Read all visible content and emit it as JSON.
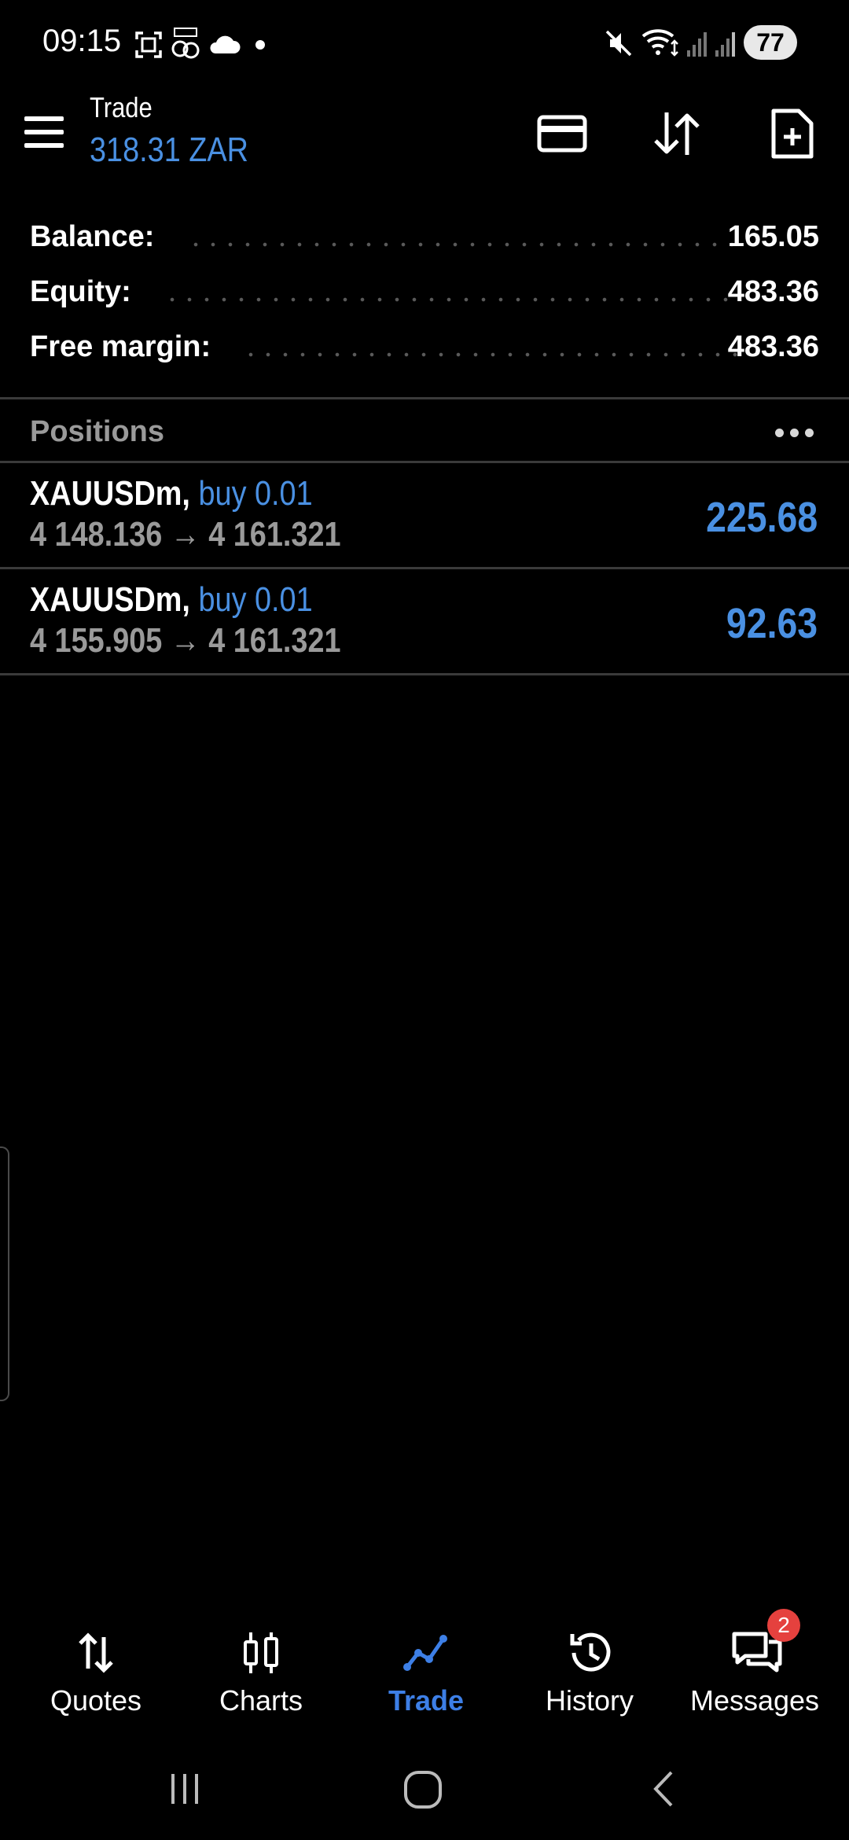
{
  "status_bar": {
    "time": "09:15",
    "battery": "77",
    "icons": [
      "screenshot-icon",
      "sixty-icon",
      "cloud-icon",
      "dot-icon",
      "mute-icon",
      "wifi-icon",
      "signal-icon",
      "signal-icon"
    ]
  },
  "header": {
    "title": "Trade",
    "subtitle": "318.31 ZAR",
    "actions": [
      "card-icon",
      "sort-icon",
      "new-order-icon"
    ]
  },
  "account": {
    "rows": [
      {
        "label": "Balance:",
        "value": "165.05"
      },
      {
        "label": "Equity:",
        "value": "483.36"
      },
      {
        "label": "Free margin:",
        "value": "483.36"
      }
    ]
  },
  "positions": {
    "title": "Positions",
    "items": [
      {
        "symbol": "XAUUSDm,",
        "side": "buy 0.01",
        "prices": "4 148.136 → 4 161.321",
        "profit": "225.68"
      },
      {
        "symbol": "XAUUSDm,",
        "side": "buy 0.01",
        "prices": "4 155.905 → 4 161.321",
        "profit": "92.63"
      }
    ]
  },
  "bottom_nav": {
    "items": [
      {
        "label": "Quotes",
        "icon": "quotes-icon",
        "active": false
      },
      {
        "label": "Charts",
        "icon": "charts-icon",
        "active": false
      },
      {
        "label": "Trade",
        "icon": "trade-icon",
        "active": true
      },
      {
        "label": "History",
        "icon": "history-icon",
        "active": false
      },
      {
        "label": "Messages",
        "icon": "messages-icon",
        "active": false
      }
    ],
    "messages_badge": "2"
  },
  "colors": {
    "accent": "#4a90e2",
    "background": "#000000",
    "muted_text": "#9a9a9a",
    "badge": "#e5413e"
  }
}
